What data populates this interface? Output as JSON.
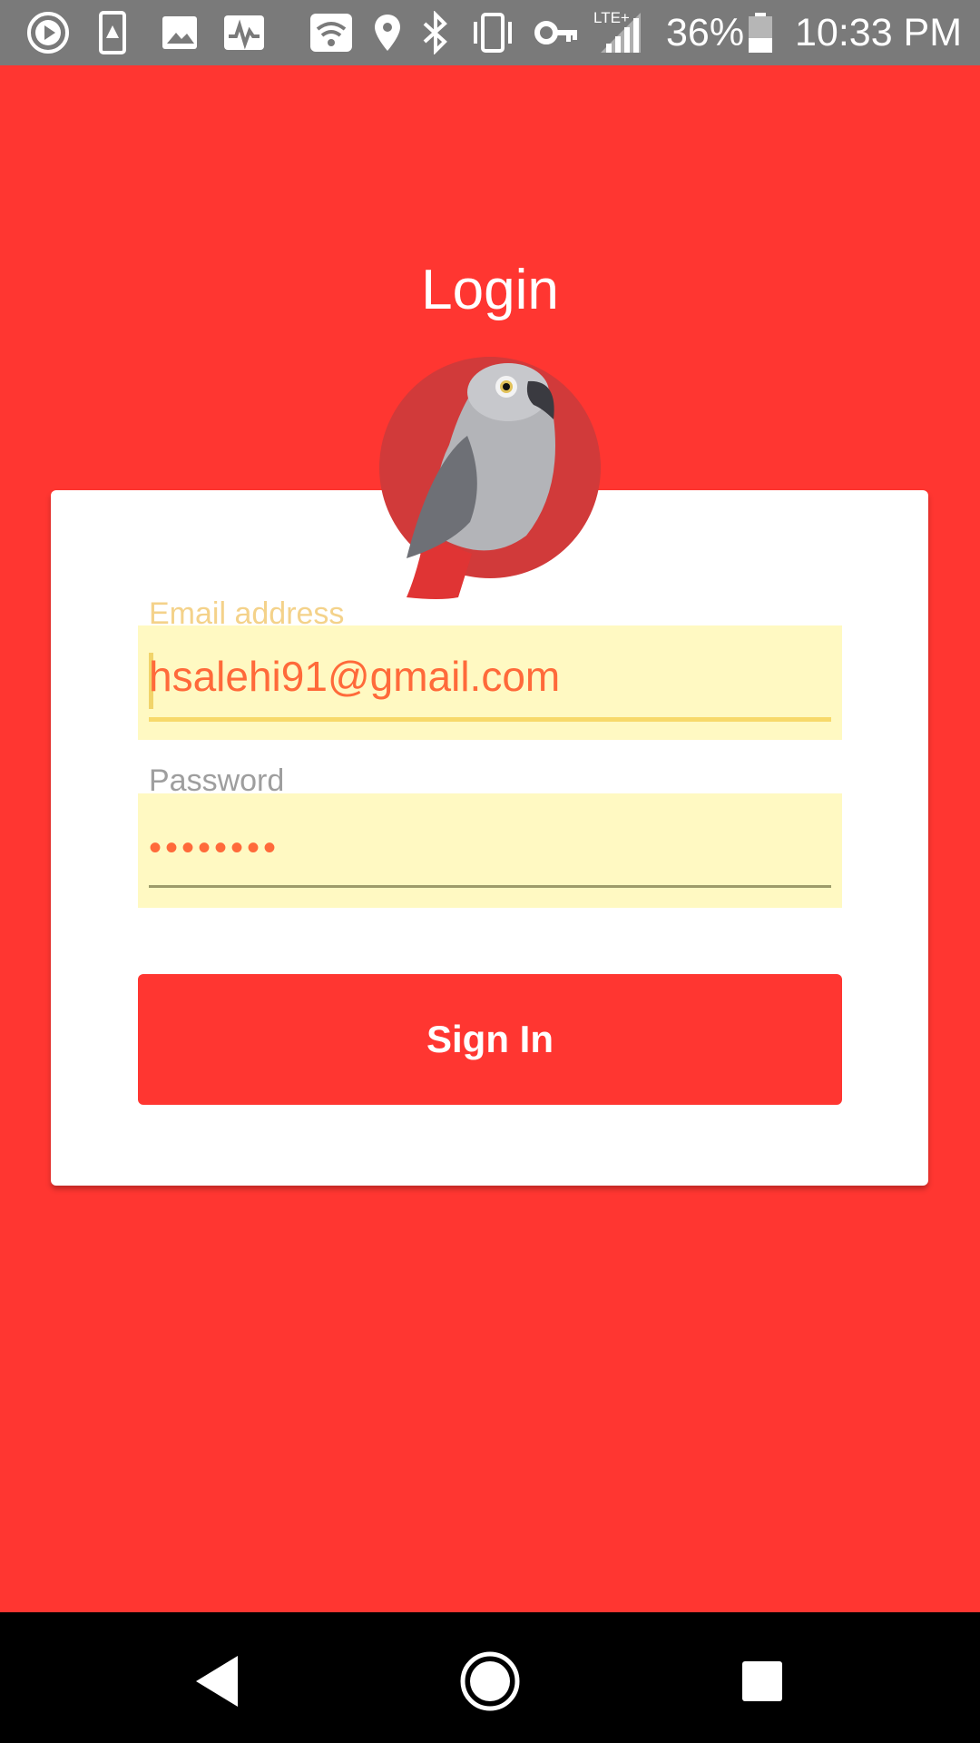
{
  "status_bar": {
    "battery_percent": "36%",
    "time": "10:33 PM",
    "network": "LTE+",
    "icons": [
      "play-icon",
      "sim-alert-icon",
      "image-icon",
      "activity-icon",
      "wifi-icon",
      "location-icon",
      "bluetooth-icon",
      "vibrate-icon",
      "key-icon",
      "signal-icon",
      "battery-icon"
    ]
  },
  "page": {
    "title": "Login",
    "background_color": "#ff3631"
  },
  "login_form": {
    "email_label": "Email address",
    "email_value": "hsalehi91@gmail.com",
    "password_label": "Password",
    "password_value": "••••••••",
    "sign_in_label": "Sign In"
  },
  "nav_bar": {
    "icons": [
      "back-icon",
      "home-icon",
      "recents-icon"
    ]
  }
}
